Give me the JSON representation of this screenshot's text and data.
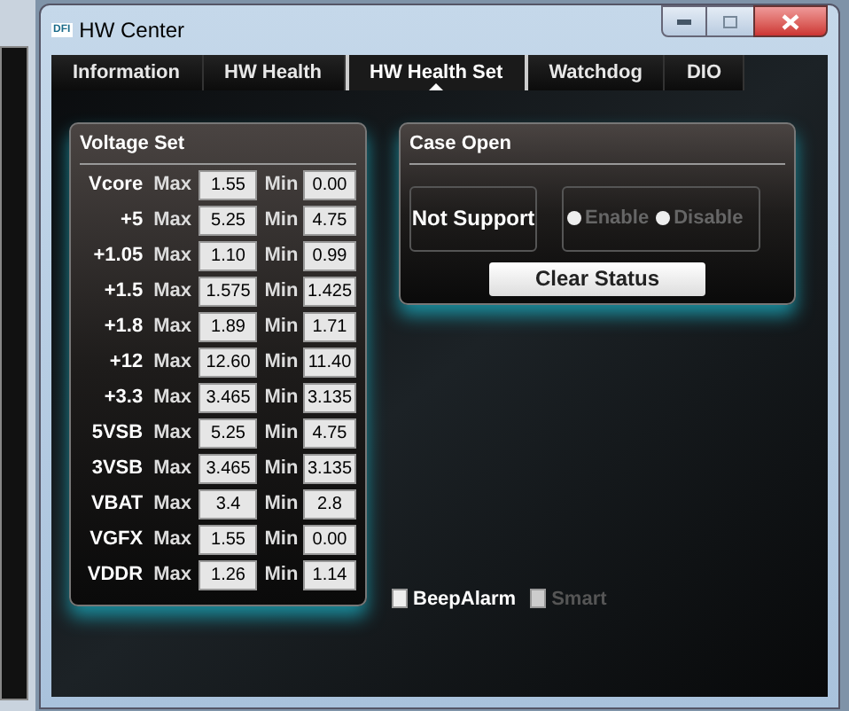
{
  "window": {
    "title": "HW Center",
    "logo": "DFI"
  },
  "tabs": [
    {
      "label": "Information",
      "selected": false
    },
    {
      "label": "HW Health",
      "selected": false
    },
    {
      "label": "HW Health Set",
      "selected": true
    },
    {
      "label": "Watchdog",
      "selected": false
    },
    {
      "label": "DIO",
      "selected": false
    }
  ],
  "voltage_set": {
    "title": "Voltage Set",
    "rows": [
      {
        "name": "Vcore",
        "max_label": "Max",
        "max": "1.55",
        "min_label": "Min",
        "min": "0.00"
      },
      {
        "name": "+5",
        "max_label": "Max",
        "max": "5.25",
        "min_label": "Min",
        "min": "4.75"
      },
      {
        "name": "+1.05",
        "max_label": "Max",
        "max": "1.10",
        "min_label": "Min",
        "min": "0.99"
      },
      {
        "name": "+1.5",
        "max_label": "Max",
        "max": "1.575",
        "min_label": "Min",
        "min": "1.425"
      },
      {
        "name": "+1.8",
        "max_label": "Max",
        "max": "1.89",
        "min_label": "Min",
        "min": "1.71"
      },
      {
        "name": "+12",
        "max_label": "Max",
        "max": "12.60",
        "min_label": "Min",
        "min": "11.40"
      },
      {
        "name": "+3.3",
        "max_label": "Max",
        "max": "3.465",
        "min_label": "Min",
        "min": "3.135"
      },
      {
        "name": "5VSB",
        "max_label": "Max",
        "max": "5.25",
        "min_label": "Min",
        "min": "4.75"
      },
      {
        "name": "3VSB",
        "max_label": "Max",
        "max": "3.465",
        "min_label": "Min",
        "min": "3.135"
      },
      {
        "name": "VBAT",
        "max_label": "Max",
        "max": "3.4",
        "min_label": "Min",
        "min": "2.8"
      },
      {
        "name": "VGFX",
        "max_label": "Max",
        "max": "1.55",
        "min_label": "Min",
        "min": "0.00"
      },
      {
        "name": "VDDR",
        "max_label": "Max",
        "max": "1.26",
        "min_label": "Min",
        "min": "1.14"
      }
    ]
  },
  "case_open": {
    "title": "Case Open",
    "status": "Not Support",
    "options": [
      {
        "label": "Enable",
        "selected": false,
        "disabled": true
      },
      {
        "label": "Disable",
        "selected": false,
        "disabled": true
      }
    ],
    "clear_button": "Clear Status"
  },
  "checkboxes": [
    {
      "label": "BeepAlarm",
      "checked": false,
      "disabled": false
    },
    {
      "label": "Smart",
      "checked": false,
      "disabled": true
    }
  ]
}
